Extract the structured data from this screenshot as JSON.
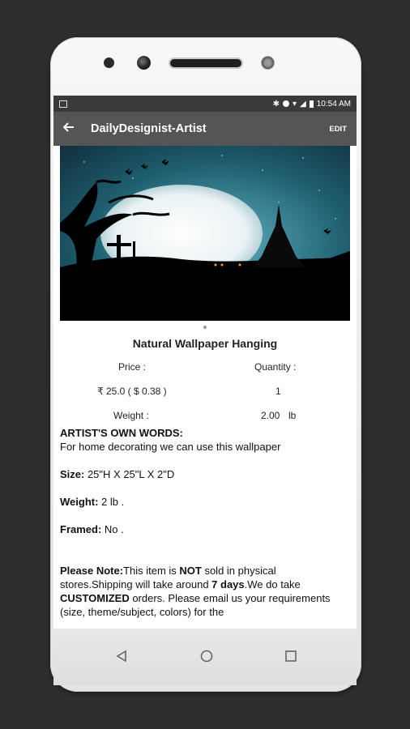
{
  "status": {
    "time": "10:54 AM"
  },
  "appbar": {
    "title": "DailyDesignist-Artist",
    "edit_label": "EDIT"
  },
  "product": {
    "title": "Natural Wallpaper Hanging",
    "price_label": "Price :",
    "quantity_label": "Quantity :",
    "price_value": "₹ 25.0 ( $ 0.38 )",
    "quantity_value": "1",
    "weight_label": "Weight :",
    "weight_value": "2.00",
    "weight_unit": "lb"
  },
  "details": {
    "artist_heading": "ARTIST'S OWN WORDS:",
    "artist_text": "For home decorating we can use this wallpaper",
    "size_label": "Size:",
    "size_value": " 25\"H X 25\"L X 2\"D",
    "weight_label": "Weight:",
    "weight_value": " 2 lb .",
    "framed_label": "Framed:",
    "framed_value": " No .",
    "note_label": "Please Note:",
    "note_text_1": "This item is ",
    "note_not": "NOT",
    "note_text_2": " sold in physical stores.Shipping will take around ",
    "note_days": "7 days",
    "note_text_3": ".We do take ",
    "note_customized": "CUSTOMIZED",
    "note_text_4": " orders. Please email us your requirements (size, theme/subject, colors) for the"
  },
  "icons": {
    "back": "arrow-left-icon",
    "nav_back": "triangle-back-icon",
    "nav_home": "circle-home-icon",
    "nav_recents": "square-recents-icon"
  },
  "colors": {
    "appbar": "#555555",
    "statusbar": "#3a3a3a"
  }
}
